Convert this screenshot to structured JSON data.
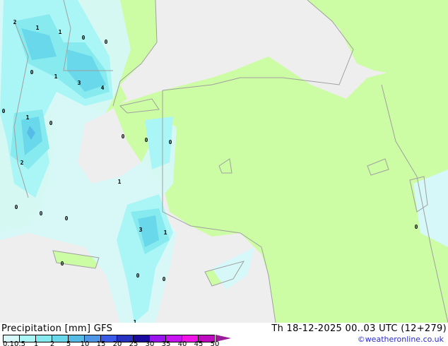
{
  "title": "Precipitation [mm]",
  "model": "GFS",
  "datetime": "Th 18-12-2025 00..03 UTC (12+279)",
  "credit": "©weatheronline.co.uk",
  "colors": {
    "sea": "#eeeeee",
    "land": "#ccfca4",
    "border": "#a0a0a0"
  },
  "colorbar": {
    "ticks": [
      "0.1",
      "0.5",
      "1",
      "2",
      "5",
      "10",
      "15",
      "20",
      "25",
      "30",
      "35",
      "40",
      "45",
      "50"
    ],
    "colors": [
      "#d6f8f8",
      "#aaf6f6",
      "#86eaee",
      "#68d8ea",
      "#56bce6",
      "#5096e6",
      "#3c5ae8",
      "#2832c0",
      "#1a0aa0",
      "#9a14f0",
      "#c814f0",
      "#f014e6",
      "#c00ac0"
    ]
  },
  "map_labels": [
    {
      "text": "2"
    },
    {
      "text": "1"
    },
    {
      "text": "1"
    },
    {
      "text": "0"
    },
    {
      "text": "0"
    },
    {
      "text": "0"
    },
    {
      "text": "1"
    },
    {
      "text": "3"
    },
    {
      "text": "4"
    },
    {
      "text": "0"
    },
    {
      "text": "1"
    },
    {
      "text": "0"
    },
    {
      "text": "2"
    },
    {
      "text": "0"
    },
    {
      "text": "0"
    },
    {
      "text": "0"
    },
    {
      "text": "1"
    },
    {
      "text": "0"
    },
    {
      "text": "0"
    },
    {
      "text": "0"
    },
    {
      "text": "3"
    },
    {
      "text": "1"
    },
    {
      "text": "0"
    },
    {
      "text": "0"
    },
    {
      "text": "0"
    },
    {
      "text": "1"
    },
    {
      "text": "0"
    }
  ]
}
